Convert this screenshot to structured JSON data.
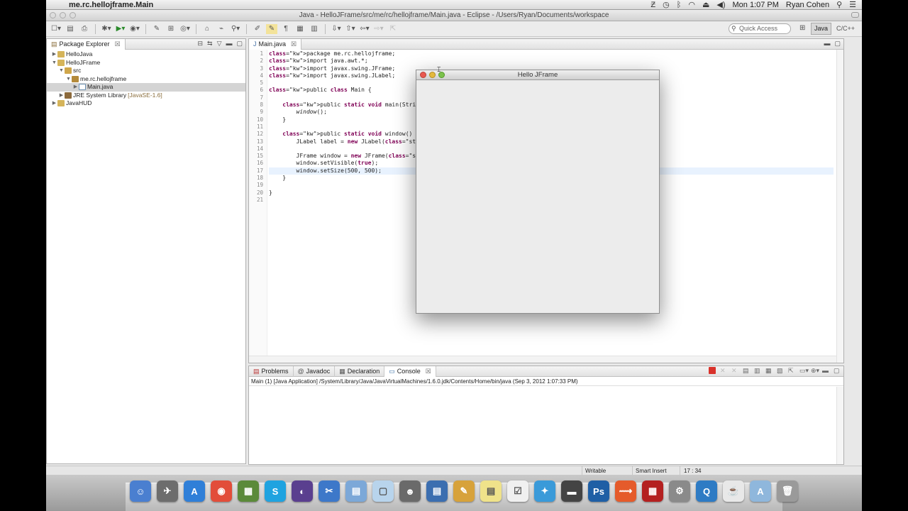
{
  "menubar": {
    "app_name": "me.rc.hellojframe.Main",
    "clock": "Mon 1:07 PM",
    "user": "Ryan Cohen"
  },
  "window": {
    "title": "Java - HelloJFrame/src/me/rc/hellojframe/Main.java - Eclipse - /Users/Ryan/Documents/workspace"
  },
  "toolbar": {
    "quick_access_placeholder": "Quick Access",
    "perspective_java": "Java",
    "perspective_cpp": "C/C++"
  },
  "package_explorer": {
    "tab_label": "Package Explorer",
    "items": [
      {
        "label": "HelloJava",
        "twisty": "▶",
        "icon": "proj"
      },
      {
        "label": "HelloJFrame",
        "twisty": "▼",
        "icon": "proj"
      },
      {
        "label": "src",
        "twisty": "▼",
        "icon": "folder"
      },
      {
        "label": "me.rc.hellojframe",
        "twisty": "▼",
        "icon": "pkg"
      },
      {
        "label": "Main.java",
        "twisty": "▶",
        "icon": "java",
        "selected": true
      },
      {
        "label": "JRE System Library",
        "suffix": "[JavaSE-1.6]",
        "twisty": "▶",
        "icon": "jar"
      },
      {
        "label": "JavaHUD",
        "twisty": "▶",
        "icon": "proj"
      }
    ]
  },
  "editor": {
    "tab_label": "Main.java",
    "lines": [
      {
        "n": "1",
        "text": "package me.rc.hellojframe;"
      },
      {
        "n": "2",
        "text": "import java.awt.*;"
      },
      {
        "n": "3",
        "text": "import javax.swing.JFrame;"
      },
      {
        "n": "4",
        "text": "import javax.swing.JLabel;"
      },
      {
        "n": "5",
        "text": ""
      },
      {
        "n": "6",
        "text": "public class Main {"
      },
      {
        "n": "7",
        "text": ""
      },
      {
        "n": "8",
        "text": "    public static void main(String[] args) {"
      },
      {
        "n": "9",
        "text": "        window();"
      },
      {
        "n": "10",
        "text": "    }"
      },
      {
        "n": "11",
        "text": ""
      },
      {
        "n": "12",
        "text": "    public static void window() {"
      },
      {
        "n": "13",
        "text": "        JLabel label = new JLabel(\"Hello Wo"
      },
      {
        "n": "14",
        "text": ""
      },
      {
        "n": "15",
        "text": "        JFrame window = new JFrame(\"Hello J"
      },
      {
        "n": "16",
        "text": "        window.setVisible(true);"
      },
      {
        "n": "17",
        "text": "        window.setSize(500, 500);"
      },
      {
        "n": "18",
        "text": "    }"
      },
      {
        "n": "19",
        "text": ""
      },
      {
        "n": "20",
        "text": "}"
      },
      {
        "n": "21",
        "text": ""
      }
    ]
  },
  "bottom_panel": {
    "tabs": [
      "Problems",
      "Javadoc",
      "Declaration",
      "Console"
    ],
    "active_tab": "Console",
    "console_header": "Main (1) [Java Application] /System/Library/Java/JavaVirtualMachines/1.6.0.jdk/Contents/Home/bin/java (Sep 3, 2012 1:07:33 PM)"
  },
  "statusbar": {
    "writable": "Writable",
    "insert_mode": "Smart Insert",
    "position": "17 : 34"
  },
  "jframe": {
    "title": "Hello JFrame"
  },
  "dock": {
    "apps": [
      "finder-icon",
      "launchpad-icon",
      "app-store-icon",
      "chrome-icon",
      "minecraft-icon",
      "skype-icon",
      "eclipse-icon",
      "xcode-icon",
      "preview-icon",
      "cube-icon",
      "guy-icon",
      "folder-notes-icon",
      "pencil-icon",
      "stickies-icon",
      "todo-icon",
      "twitter-icon",
      "screen-icon",
      "photoshop-icon",
      "ftp-icon",
      "film-icon",
      "gear-icon",
      "quicktime-icon",
      "coffee-icon",
      "applications-folder-icon",
      "trash-icon"
    ]
  }
}
